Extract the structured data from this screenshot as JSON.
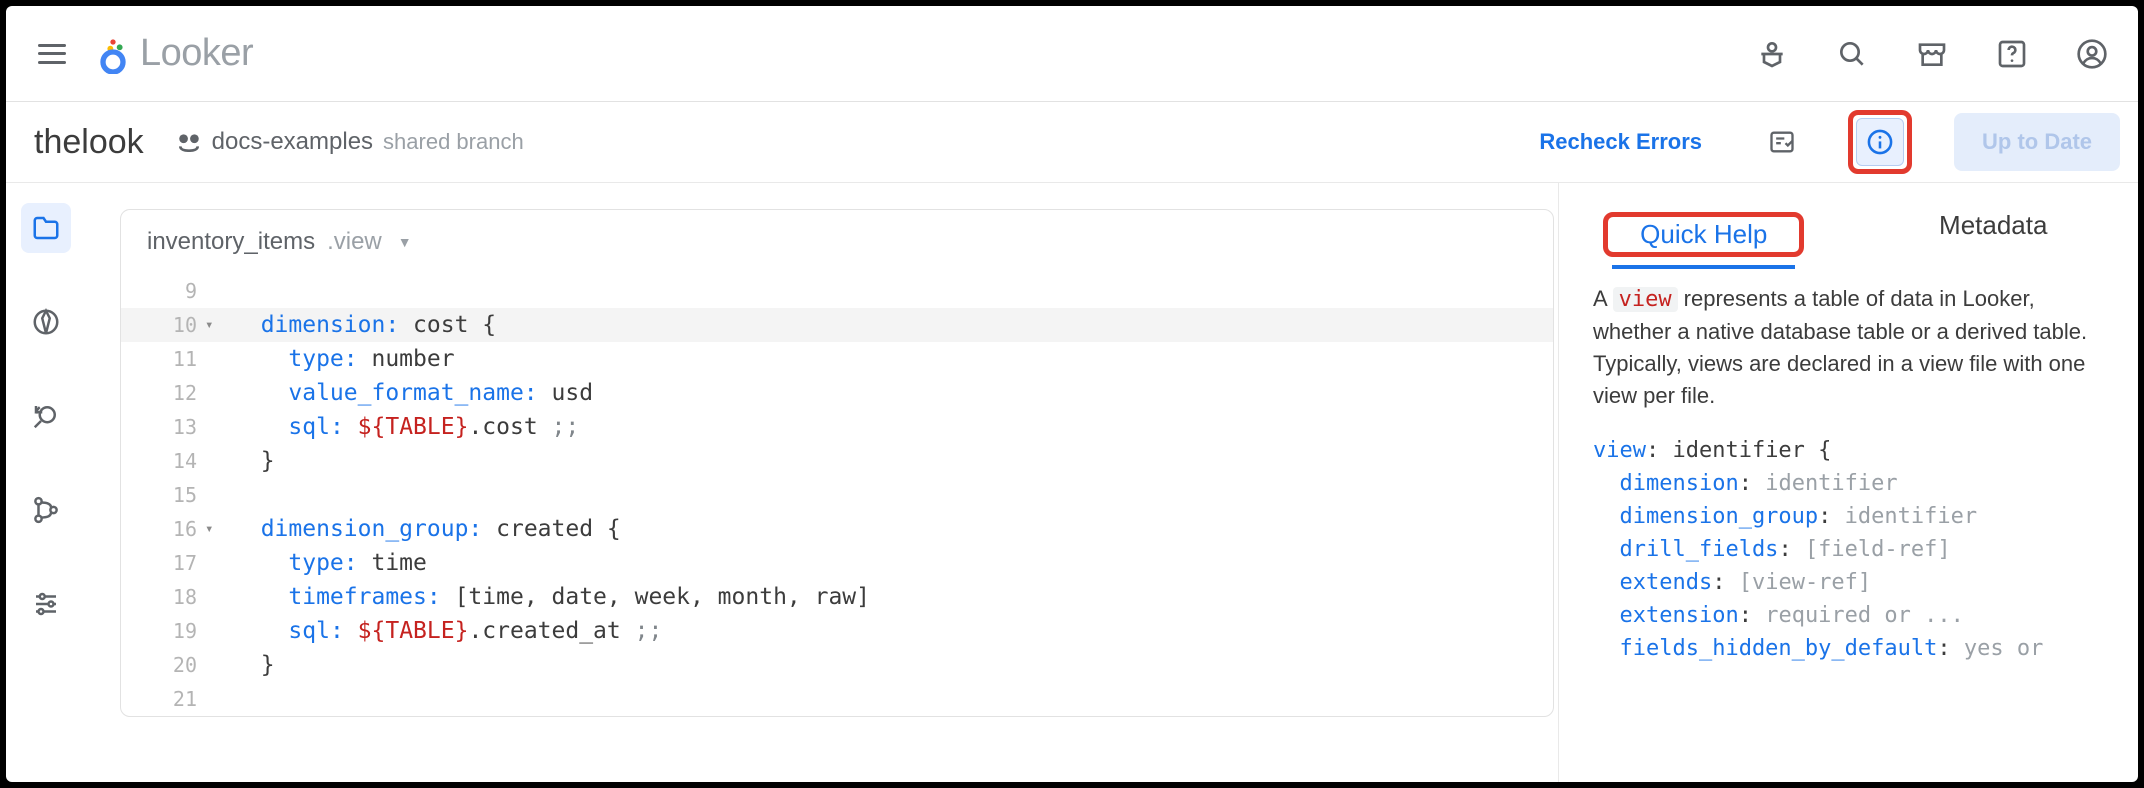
{
  "brand": {
    "name": "Looker"
  },
  "project": {
    "name": "thelook",
    "branch": "docs-examples",
    "branch_subtitle": "shared branch",
    "recheck_label": "Recheck Errors",
    "status_label": "Up to Date"
  },
  "editor": {
    "file_basename": "inventory_items",
    "file_ext": ".view",
    "lines": [
      {
        "n": 9,
        "fold": "",
        "hl": false,
        "tokens": []
      },
      {
        "n": 10,
        "fold": "▾",
        "hl": true,
        "tokens": [
          [
            "  ",
            ""
          ],
          [
            "dimension",
            "kw"
          ],
          [
            ":",
            "op"
          ],
          [
            " cost {",
            ""
          ]
        ]
      },
      {
        "n": 11,
        "fold": "",
        "hl": false,
        "tokens": [
          [
            "    ",
            ""
          ],
          [
            "type",
            "kw"
          ],
          [
            ":",
            "op"
          ],
          [
            " number",
            ""
          ]
        ]
      },
      {
        "n": 12,
        "fold": "",
        "hl": false,
        "tokens": [
          [
            "    ",
            ""
          ],
          [
            "value_format_name",
            "kw"
          ],
          [
            ":",
            "op"
          ],
          [
            " usd",
            ""
          ]
        ]
      },
      {
        "n": 13,
        "fold": "",
        "hl": false,
        "tokens": [
          [
            "    ",
            ""
          ],
          [
            "sql",
            "kw"
          ],
          [
            ":",
            "op"
          ],
          [
            " ",
            ""
          ],
          [
            "${TABLE}",
            "var"
          ],
          [
            ".cost ",
            ""
          ],
          [
            ";;",
            "mut"
          ]
        ]
      },
      {
        "n": 14,
        "fold": "",
        "hl": false,
        "tokens": [
          [
            "  }",
            ""
          ]
        ]
      },
      {
        "n": 15,
        "fold": "",
        "hl": false,
        "tokens": []
      },
      {
        "n": 16,
        "fold": "▾",
        "hl": false,
        "tokens": [
          [
            "  ",
            ""
          ],
          [
            "dimension_group",
            "kw"
          ],
          [
            ":",
            "op"
          ],
          [
            " created {",
            ""
          ]
        ]
      },
      {
        "n": 17,
        "fold": "",
        "hl": false,
        "tokens": [
          [
            "    ",
            ""
          ],
          [
            "type",
            "kw"
          ],
          [
            ":",
            "op"
          ],
          [
            " time",
            ""
          ]
        ]
      },
      {
        "n": 18,
        "fold": "",
        "hl": false,
        "tokens": [
          [
            "    ",
            ""
          ],
          [
            "timeframes",
            "kw"
          ],
          [
            ":",
            "op"
          ],
          [
            " [time, date, week, month, raw]",
            ""
          ]
        ]
      },
      {
        "n": 19,
        "fold": "",
        "hl": false,
        "tokens": [
          [
            "    ",
            ""
          ],
          [
            "sql",
            "kw"
          ],
          [
            ":",
            "op"
          ],
          [
            " ",
            ""
          ],
          [
            "${TABLE}",
            "var"
          ],
          [
            ".created_at ",
            ""
          ],
          [
            ";;",
            "mut"
          ]
        ]
      },
      {
        "n": 20,
        "fold": "",
        "hl": false,
        "tokens": [
          [
            "  }",
            ""
          ]
        ]
      },
      {
        "n": 21,
        "fold": "",
        "hl": false,
        "tokens": []
      }
    ]
  },
  "panel": {
    "tabs": {
      "quick_help": "Quick Help",
      "metadata": "Metadata",
      "active": "quick_help"
    },
    "help_intro_prefix": "A ",
    "help_intro_code": "view",
    "help_intro_suffix": " represents a table of data in Looker, whether a native database table or a derived table. Typically, views are declared in a view file with one view per file.",
    "help_example": [
      [
        [
          "view",
          "kw"
        ],
        [
          ": identifier {",
          ""
        ]
      ],
      [
        [
          "  dimension",
          "kw"
        ],
        [
          ": ",
          ""
        ],
        [
          "identifier",
          "dim"
        ]
      ],
      [
        [
          "  dimension_group",
          "kw"
        ],
        [
          ": ",
          ""
        ],
        [
          "identifier",
          "dim"
        ]
      ],
      [
        [
          "  drill_fields",
          "kw"
        ],
        [
          ": ",
          ""
        ],
        [
          "[field-ref]",
          "dim"
        ]
      ],
      [
        [
          "  extends",
          "kw"
        ],
        [
          ": ",
          ""
        ],
        [
          "[view-ref]",
          "dim"
        ]
      ],
      [
        [
          "  extension",
          "kw"
        ],
        [
          ": ",
          ""
        ],
        [
          "required or ...",
          "dim"
        ]
      ],
      [
        [
          "  fields_hidden_by_default",
          "kw"
        ],
        [
          ": ",
          ""
        ],
        [
          "yes or",
          "dim"
        ]
      ]
    ]
  }
}
